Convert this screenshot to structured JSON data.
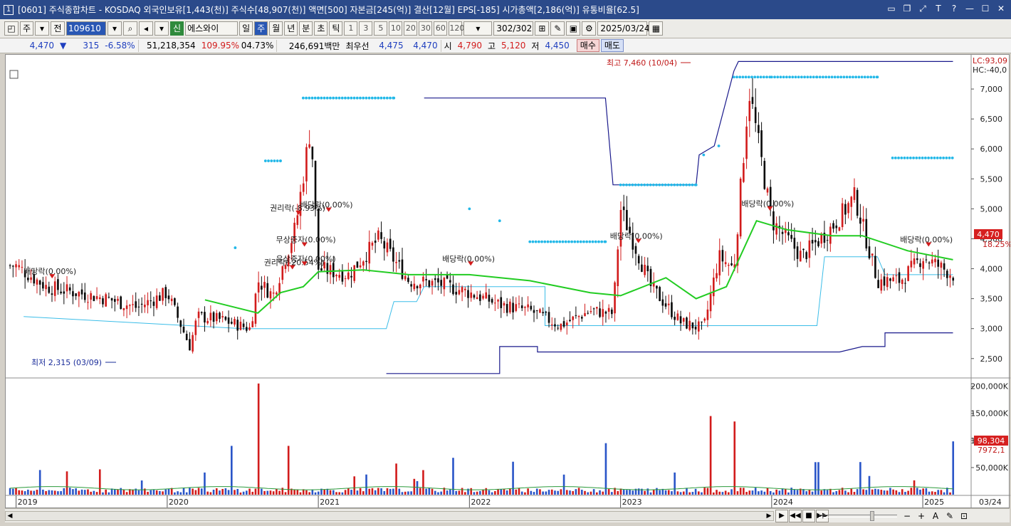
{
  "window": {
    "title": "[0601] 주식종합차트 - KOSDAQ 외국인보유[1,443(천)] 주식수[48,907(천)] 액면[500] 자본금[245(억)] 결산[12월] EPS[-185] 시가총액[2,186(억)] 유통비율[62.5]",
    "app_icon": "1"
  },
  "toolbar": {
    "type_select": "주",
    "all_btn": "전",
    "code": "109610",
    "shin": "신",
    "stock_name": "에스와이",
    "periods": [
      "일",
      "주",
      "월",
      "년",
      "분",
      "초",
      "틱"
    ],
    "active_period": "주",
    "intervals": [
      "1",
      "3",
      "5",
      "10",
      "20",
      "30",
      "60",
      "120"
    ],
    "count": "302/302",
    "date": "2025/03/24"
  },
  "quote": {
    "price": "4,470",
    "change": "315",
    "change_pct": "-6.58%",
    "volume": "51,218,354",
    "vol_ratio": "109.95%",
    "turnover": "04.73%",
    "amount": "246,691백만",
    "best_label": "최우선",
    "best_ask": "4,475",
    "best_bid": "4,470",
    "open_label": "시",
    "open": "4,790",
    "high_label": "고",
    "high": "5,120",
    "low_label": "저",
    "low": "4,450",
    "buy_label": "매수",
    "sell_label": "매도"
  },
  "chart_labels": {
    "high_note": "최고 7,460 (10/04)",
    "low_note": "최저 2,315 (03/09)",
    "lc": "LC:93,09",
    "hc": "HC:-40,0",
    "price_tag": "4,470",
    "pct_tag": "18.25%",
    "vol_tag": "98,304",
    "vol_ma_tag": "7972,1",
    "events": [
      {
        "text": "배당락(0.00%)"
      },
      {
        "text": "권리락(-8.93%)"
      },
      {
        "text": "배당락(0.00%)"
      },
      {
        "text": "무상증자(0.00%)"
      },
      {
        "text": "권리락(-20.54%)"
      },
      {
        "text": "유상증자(0.00%)"
      },
      {
        "text": "배당락(0.00%)"
      },
      {
        "text": "배당락(0.00%)"
      },
      {
        "text": "배당락(0.00%)"
      },
      {
        "text": "배당락(0.00%)"
      }
    ]
  },
  "colors": {
    "up": "#d21c1c",
    "down": "#0a0a0a",
    "ma": "#22cc22",
    "parabolic": "#22b8e8",
    "envelope": "#1a1a8c",
    "volume_down": "#2a55c8"
  },
  "chart_data": [
    {
      "type": "line",
      "title": "",
      "x": [
        "2019",
        "2020",
        "2021",
        "2022",
        "2023",
        "2024",
        "2025",
        "03/24"
      ],
      "y_ticks": [
        2500,
        3000,
        3500,
        4000,
        4500,
        5000,
        5500,
        6000,
        6500,
        7000
      ],
      "y_tick_labels": [
        "2,500",
        "3,000",
        "3,500",
        "4,000",
        "4,500",
        "5,000",
        "5,500",
        "6,000",
        "6,500",
        "7,000"
      ],
      "ylim": [
        2200,
        7500
      ],
      "series": [
        {
          "role": "close",
          "x": [
            2019.0,
            2019.2,
            2019.4,
            2019.6,
            2019.8,
            2020.0,
            2020.15,
            2020.2,
            2020.35,
            2020.55,
            2020.6,
            2020.7,
            2020.85,
            2020.95,
            2021.0,
            2021.2,
            2021.4,
            2021.6,
            2021.8,
            2022.0,
            2022.2,
            2022.4,
            2022.6,
            2022.8,
            2022.95,
            2023.0,
            2023.2,
            2023.4,
            2023.55,
            2023.65,
            2023.75,
            2023.85,
            2024.0,
            2024.2,
            2024.4,
            2024.55,
            2024.7,
            2024.85,
            2025.0,
            2025.2
          ],
          "values": [
            4050,
            3700,
            3600,
            3500,
            3350,
            3600,
            2700,
            3200,
            3150,
            3000,
            3800,
            3550,
            4700,
            6400,
            4000,
            3900,
            4500,
            3800,
            3750,
            3600,
            3400,
            3300,
            3050,
            3300,
            3250,
            5000,
            3700,
            3100,
            3000,
            4200,
            4000,
            7000,
            4800,
            4200,
            4700,
            5200,
            3800,
            3800,
            4200,
            3900
          ]
        },
        {
          "role": "moving-average",
          "x": [
            2020.25,
            2020.6,
            2020.75,
            2020.9,
            2021.0,
            2021.3,
            2021.6,
            2022.0,
            2022.4,
            2022.8,
            2023.0,
            2023.3,
            2023.5,
            2023.7,
            2023.9,
            2024.1,
            2024.4,
            2024.6,
            2024.9,
            2025.2
          ],
          "values": [
            3480,
            3260,
            3600,
            3700,
            3950,
            3980,
            3900,
            3900,
            3800,
            3600,
            3550,
            3850,
            3500,
            3700,
            4800,
            4650,
            4550,
            4550,
            4300,
            4150
          ]
        },
        {
          "role": "parabolic-sar",
          "x": [
            2020.45,
            2020.65,
            2020.75,
            2020.9,
            2021.0,
            2021.5,
            2022.0,
            2022.2,
            2022.4,
            2022.9,
            2023.0,
            2023.5,
            2023.55,
            2023.65,
            2023.75,
            2024.0,
            2024.3,
            2024.7,
            2024.8,
            2025.2
          ],
          "values": [
            4350,
            5800,
            5800,
            6850,
            6850,
            6850,
            5000,
            4800,
            4450,
            4450,
            5400,
            5400,
            5900,
            6050,
            7200,
            7200,
            7200,
            7200,
            5850,
            5850
          ]
        }
      ]
    },
    {
      "type": "bar",
      "title": "",
      "y_ticks": [
        50000,
        100000,
        150000,
        200000
      ],
      "y_tick_labels": [
        "50,000K",
        "100,000K",
        "150,000K",
        "200,000K"
      ],
      "ylim": [
        0,
        210000
      ],
      "peaks": [
        {
          "x": 2020.6,
          "value": 205000
        },
        {
          "x": 2020.42,
          "value": 90000
        },
        {
          "x": 2020.8,
          "value": 90000
        },
        {
          "x": 2021.9,
          "value": 68000
        },
        {
          "x": 2022.9,
          "value": 95000
        },
        {
          "x": 2023.6,
          "value": 145000
        },
        {
          "x": 2023.75,
          "value": 135000
        },
        {
          "x": 2024.3,
          "value": 60000
        },
        {
          "x": 2025.2,
          "value": 98304
        }
      ]
    }
  ]
}
